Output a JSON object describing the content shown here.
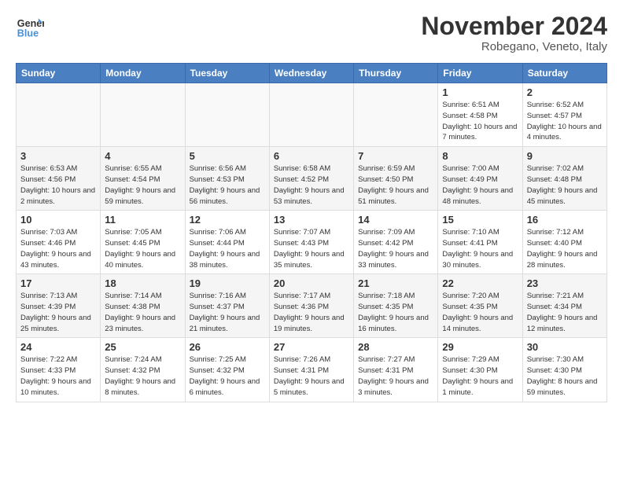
{
  "header": {
    "logo_line1": "General",
    "logo_line2": "Blue",
    "month": "November 2024",
    "location": "Robegano, Veneto, Italy"
  },
  "days_of_week": [
    "Sunday",
    "Monday",
    "Tuesday",
    "Wednesday",
    "Thursday",
    "Friday",
    "Saturday"
  ],
  "weeks": [
    [
      {
        "day": "",
        "info": ""
      },
      {
        "day": "",
        "info": ""
      },
      {
        "day": "",
        "info": ""
      },
      {
        "day": "",
        "info": ""
      },
      {
        "day": "",
        "info": ""
      },
      {
        "day": "1",
        "info": "Sunrise: 6:51 AM\nSunset: 4:58 PM\nDaylight: 10 hours and 7 minutes."
      },
      {
        "day": "2",
        "info": "Sunrise: 6:52 AM\nSunset: 4:57 PM\nDaylight: 10 hours and 4 minutes."
      }
    ],
    [
      {
        "day": "3",
        "info": "Sunrise: 6:53 AM\nSunset: 4:56 PM\nDaylight: 10 hours and 2 minutes."
      },
      {
        "day": "4",
        "info": "Sunrise: 6:55 AM\nSunset: 4:54 PM\nDaylight: 9 hours and 59 minutes."
      },
      {
        "day": "5",
        "info": "Sunrise: 6:56 AM\nSunset: 4:53 PM\nDaylight: 9 hours and 56 minutes."
      },
      {
        "day": "6",
        "info": "Sunrise: 6:58 AM\nSunset: 4:52 PM\nDaylight: 9 hours and 53 minutes."
      },
      {
        "day": "7",
        "info": "Sunrise: 6:59 AM\nSunset: 4:50 PM\nDaylight: 9 hours and 51 minutes."
      },
      {
        "day": "8",
        "info": "Sunrise: 7:00 AM\nSunset: 4:49 PM\nDaylight: 9 hours and 48 minutes."
      },
      {
        "day": "9",
        "info": "Sunrise: 7:02 AM\nSunset: 4:48 PM\nDaylight: 9 hours and 45 minutes."
      }
    ],
    [
      {
        "day": "10",
        "info": "Sunrise: 7:03 AM\nSunset: 4:46 PM\nDaylight: 9 hours and 43 minutes."
      },
      {
        "day": "11",
        "info": "Sunrise: 7:05 AM\nSunset: 4:45 PM\nDaylight: 9 hours and 40 minutes."
      },
      {
        "day": "12",
        "info": "Sunrise: 7:06 AM\nSunset: 4:44 PM\nDaylight: 9 hours and 38 minutes."
      },
      {
        "day": "13",
        "info": "Sunrise: 7:07 AM\nSunset: 4:43 PM\nDaylight: 9 hours and 35 minutes."
      },
      {
        "day": "14",
        "info": "Sunrise: 7:09 AM\nSunset: 4:42 PM\nDaylight: 9 hours and 33 minutes."
      },
      {
        "day": "15",
        "info": "Sunrise: 7:10 AM\nSunset: 4:41 PM\nDaylight: 9 hours and 30 minutes."
      },
      {
        "day": "16",
        "info": "Sunrise: 7:12 AM\nSunset: 4:40 PM\nDaylight: 9 hours and 28 minutes."
      }
    ],
    [
      {
        "day": "17",
        "info": "Sunrise: 7:13 AM\nSunset: 4:39 PM\nDaylight: 9 hours and 25 minutes."
      },
      {
        "day": "18",
        "info": "Sunrise: 7:14 AM\nSunset: 4:38 PM\nDaylight: 9 hours and 23 minutes."
      },
      {
        "day": "19",
        "info": "Sunrise: 7:16 AM\nSunset: 4:37 PM\nDaylight: 9 hours and 21 minutes."
      },
      {
        "day": "20",
        "info": "Sunrise: 7:17 AM\nSunset: 4:36 PM\nDaylight: 9 hours and 19 minutes."
      },
      {
        "day": "21",
        "info": "Sunrise: 7:18 AM\nSunset: 4:35 PM\nDaylight: 9 hours and 16 minutes."
      },
      {
        "day": "22",
        "info": "Sunrise: 7:20 AM\nSunset: 4:35 PM\nDaylight: 9 hours and 14 minutes."
      },
      {
        "day": "23",
        "info": "Sunrise: 7:21 AM\nSunset: 4:34 PM\nDaylight: 9 hours and 12 minutes."
      }
    ],
    [
      {
        "day": "24",
        "info": "Sunrise: 7:22 AM\nSunset: 4:33 PM\nDaylight: 9 hours and 10 minutes."
      },
      {
        "day": "25",
        "info": "Sunrise: 7:24 AM\nSunset: 4:32 PM\nDaylight: 9 hours and 8 minutes."
      },
      {
        "day": "26",
        "info": "Sunrise: 7:25 AM\nSunset: 4:32 PM\nDaylight: 9 hours and 6 minutes."
      },
      {
        "day": "27",
        "info": "Sunrise: 7:26 AM\nSunset: 4:31 PM\nDaylight: 9 hours and 5 minutes."
      },
      {
        "day": "28",
        "info": "Sunrise: 7:27 AM\nSunset: 4:31 PM\nDaylight: 9 hours and 3 minutes."
      },
      {
        "day": "29",
        "info": "Sunrise: 7:29 AM\nSunset: 4:30 PM\nDaylight: 9 hours and 1 minute."
      },
      {
        "day": "30",
        "info": "Sunrise: 7:30 AM\nSunset: 4:30 PM\nDaylight: 8 hours and 59 minutes."
      }
    ]
  ]
}
